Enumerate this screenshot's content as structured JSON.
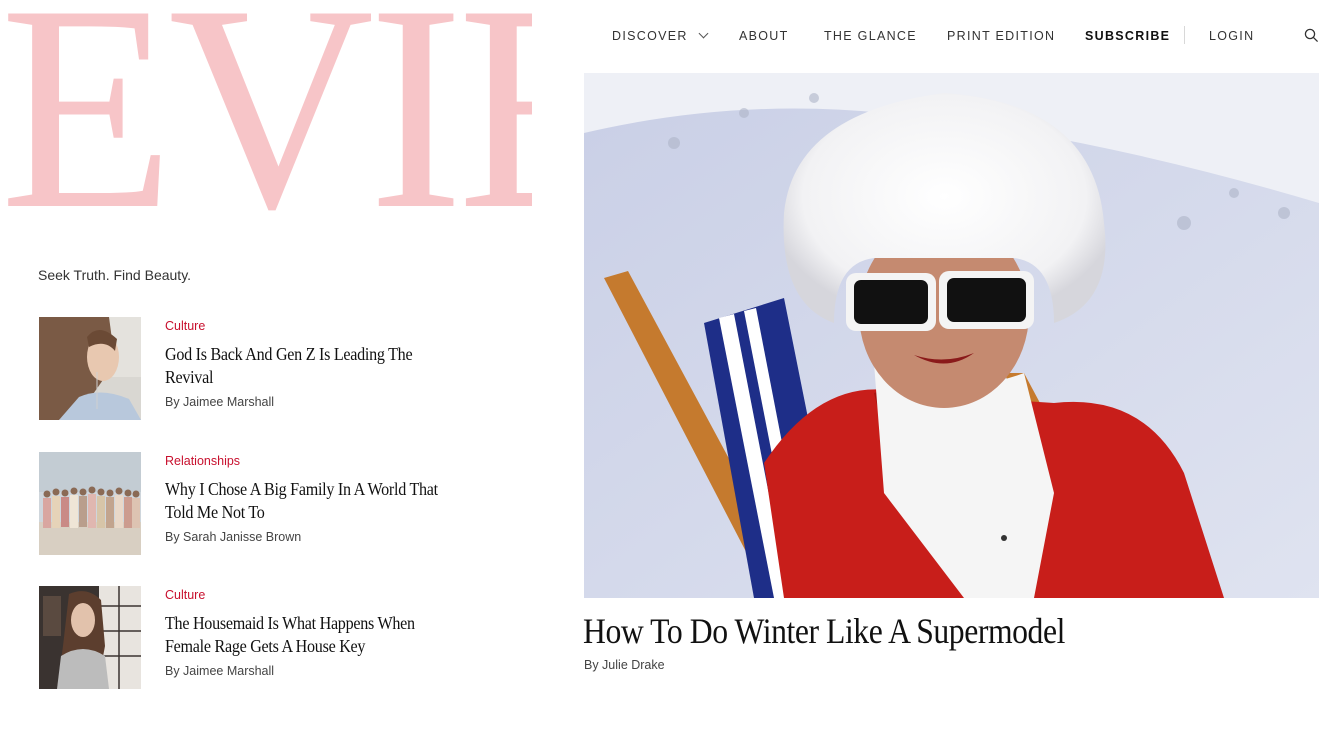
{
  "logo": "EVIE",
  "tagline": "Seek Truth. Find Beauty.",
  "nav": {
    "discover": "DISCOVER",
    "about": "ABOUT",
    "glance": "THE GLANCE",
    "print": "PRINT EDITION",
    "subscribe": "SUBSCRIBE",
    "login": "LOGIN",
    "search_icon": "search-icon"
  },
  "articles": [
    {
      "category": "Culture",
      "title": "God Is Back And Gen Z Is Leading The Revival",
      "byline": "By Jaimee Marshall"
    },
    {
      "category": "Relationships",
      "title": "Why I Chose A Big Family In A World That Told Me Not To",
      "byline": "By Sarah Janisse Brown"
    },
    {
      "category": "Culture",
      "title": "The Housemaid Is What Happens When Female Rage Gets A House Key",
      "byline": "By Jaimee Marshall"
    }
  ],
  "feature": {
    "title": "How To Do Winter Like A Supermodel",
    "byline": "By Julie Drake"
  },
  "colors": {
    "logo": "#f7c5c8",
    "category": "#c8102e",
    "text": "#222222"
  }
}
